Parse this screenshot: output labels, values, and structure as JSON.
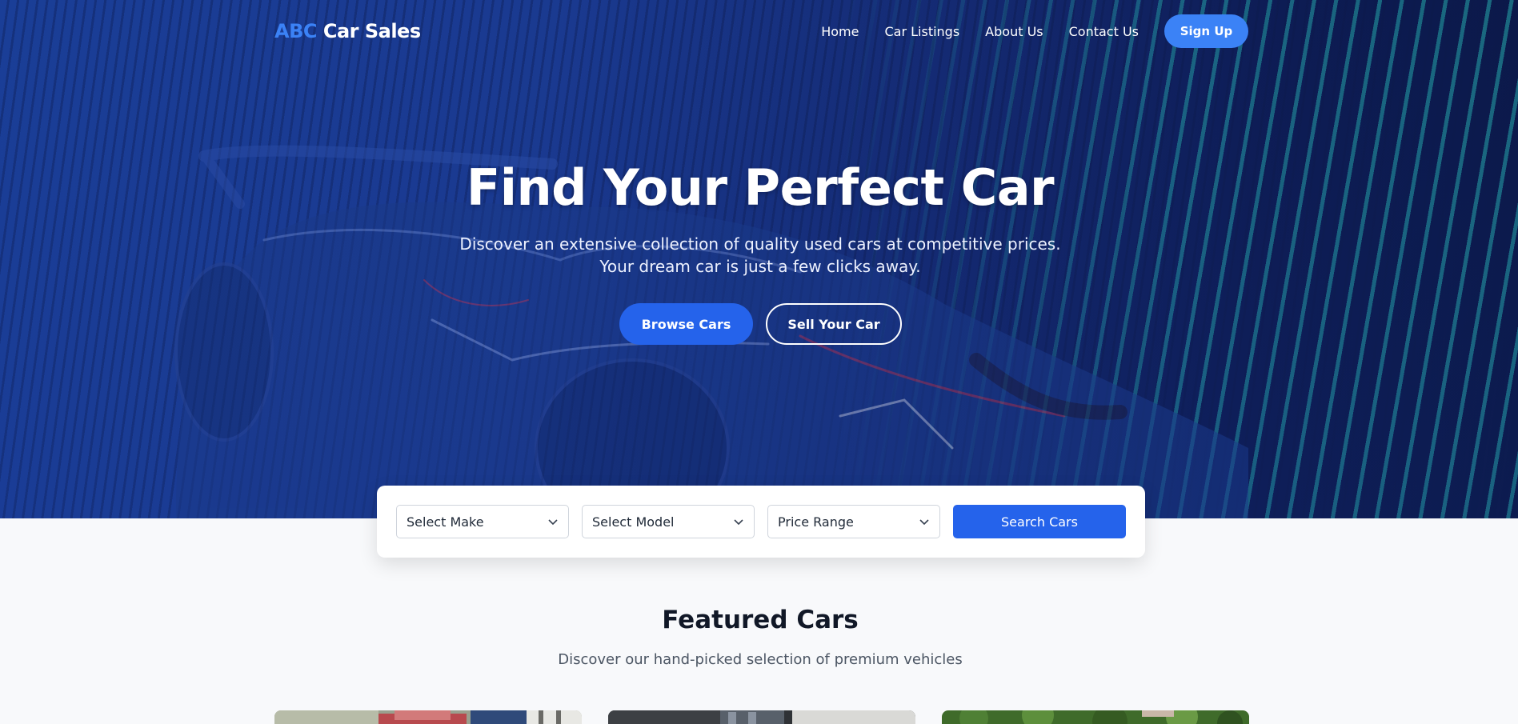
{
  "brand": {
    "abc": "ABC",
    "rest": "Car Sales"
  },
  "nav": {
    "links": [
      "Home",
      "Car Listings",
      "About Us",
      "Contact Us"
    ],
    "signup": "Sign Up"
  },
  "hero": {
    "title": "Find Your Perfect Car",
    "subtitle_line1": "Discover an extensive collection of quality used cars at competitive prices.",
    "subtitle_line2": "Your dream car is just a few clicks away.",
    "primary_button": "Browse Cars",
    "secondary_button": "Sell Your Car"
  },
  "search": {
    "make": "Select Make",
    "model": "Select Model",
    "price": "Price Range",
    "button": "Search Cars"
  },
  "featured": {
    "title": "Featured Cars",
    "subtitle": "Discover our hand-picked selection of premium vehicles"
  },
  "colors": {
    "accent": "#3b82f6",
    "primary": "#2563eb",
    "hero_bg": "#1a3a8f"
  }
}
